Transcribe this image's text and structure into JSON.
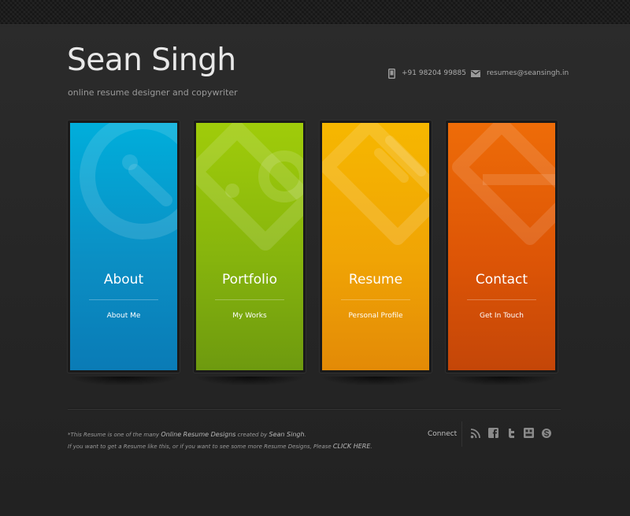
{
  "header": {
    "name": "Sean Singh",
    "tagline": "online resume designer and copywriter",
    "phone": "+91 98204 99885",
    "email": "resumes@seansingh.in"
  },
  "panels": [
    {
      "title": "About",
      "subtitle": "About Me",
      "color": "#0b8fc4",
      "icon": "clock-icon"
    },
    {
      "title": "Portfolio",
      "subtitle": "My Works",
      "color": "#86b40d",
      "icon": "tag-icon"
    },
    {
      "title": "Resume",
      "subtitle": "Personal Profile",
      "color": "#f0a405",
      "icon": "document-icon"
    },
    {
      "title": "Contact",
      "subtitle": "Get In Touch",
      "color": "#dd5506",
      "icon": "envelope-icon"
    }
  ],
  "footer": {
    "line1_pre": "*This Resume is one of the many ",
    "line1_em": "Online Resume Designs",
    "line1_mid": " created by ",
    "line1_name": "Sean Singh",
    "line1_end": ".",
    "line2_pre": "If you want to get a Resume like this, or if you want to see some more Resume Designs, Please ",
    "line2_link": "CLICK HERE",
    "line2_end": ".",
    "connect_label": "Connect",
    "social_icons": [
      "rss-icon",
      "facebook-icon",
      "twitter-icon",
      "google-plus-icon",
      "skype-icon"
    ]
  }
}
